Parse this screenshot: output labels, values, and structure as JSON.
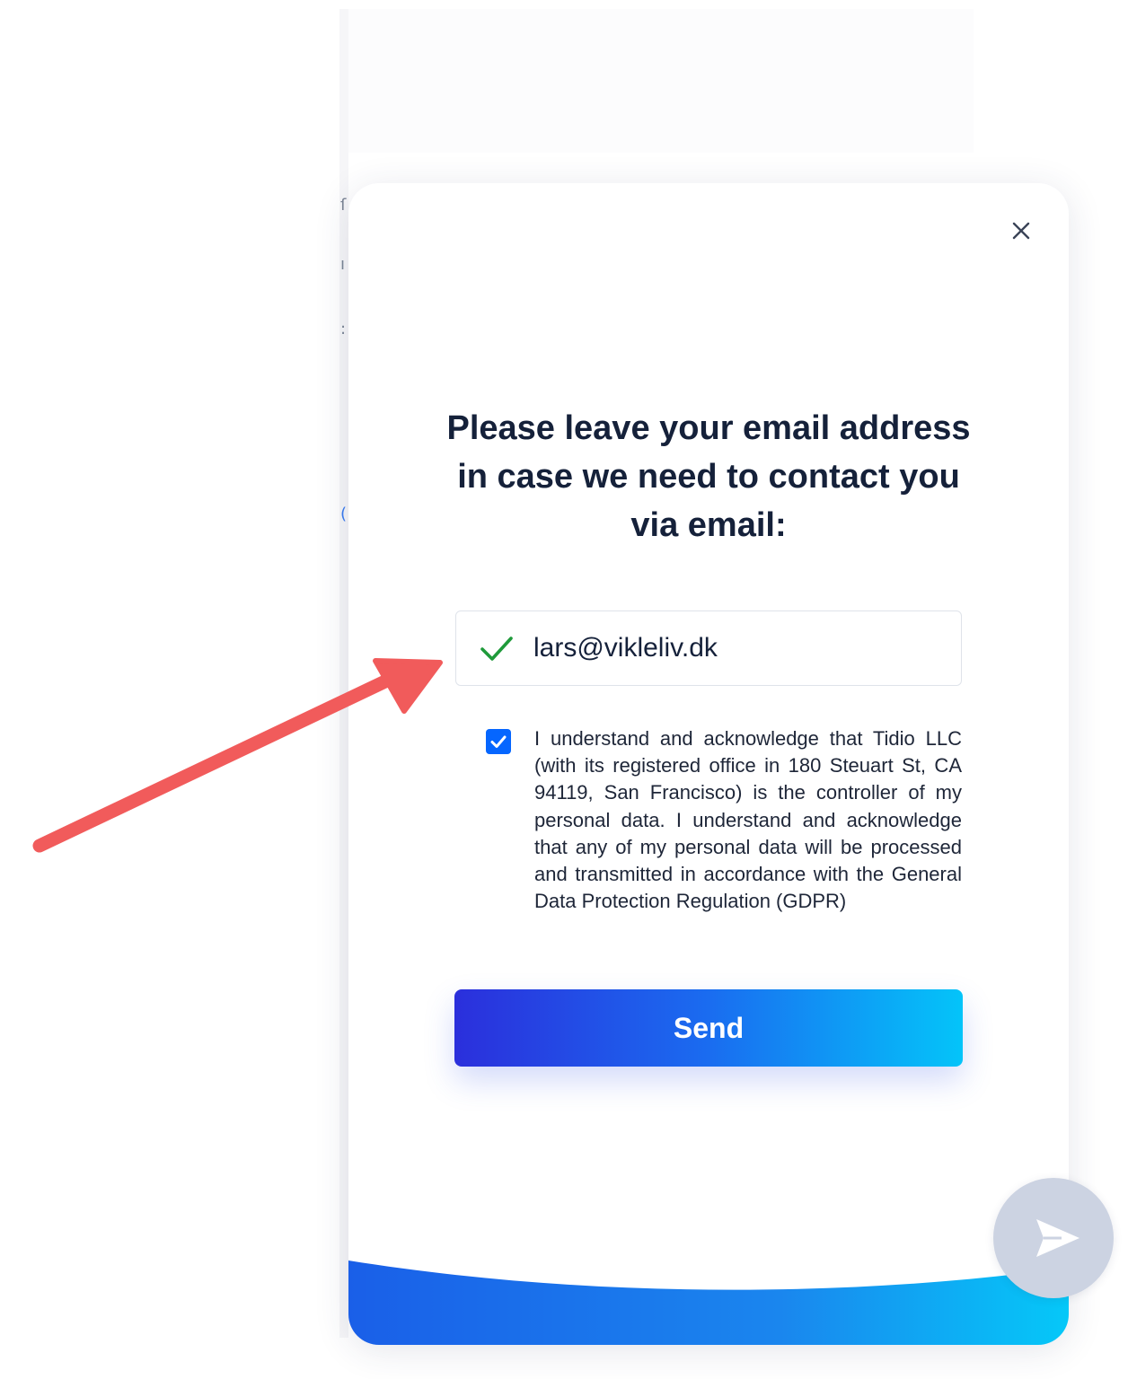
{
  "popup": {
    "heading": "Please leave your email address in case we need to contact you via email:",
    "email_value": "lars@vikleliv.dk",
    "consent_checked": true,
    "consent_text": "I understand and acknowledge that Tidio LLC (with its registered office in 180 Steuart St, CA 94119, San Francisco) is the controller of my personal data. I understand and acknowledge that any of my personal data will be processed and transmitted in accordance with the General Data Protection Regulation (GDPR)",
    "send_label": "Send",
    "close_icon": "close-icon",
    "valid_icon": "check-icon"
  },
  "launcher": {
    "icon": "paper-plane-icon"
  },
  "colors": {
    "heading_text": "#15213a",
    "checkbox": "#0566ff",
    "valid_check": "#1f9a3a",
    "button_gradient_start": "#2b2fdc",
    "button_gradient_end": "#04c4f9",
    "annotation_arrow": "#f15b5b"
  }
}
